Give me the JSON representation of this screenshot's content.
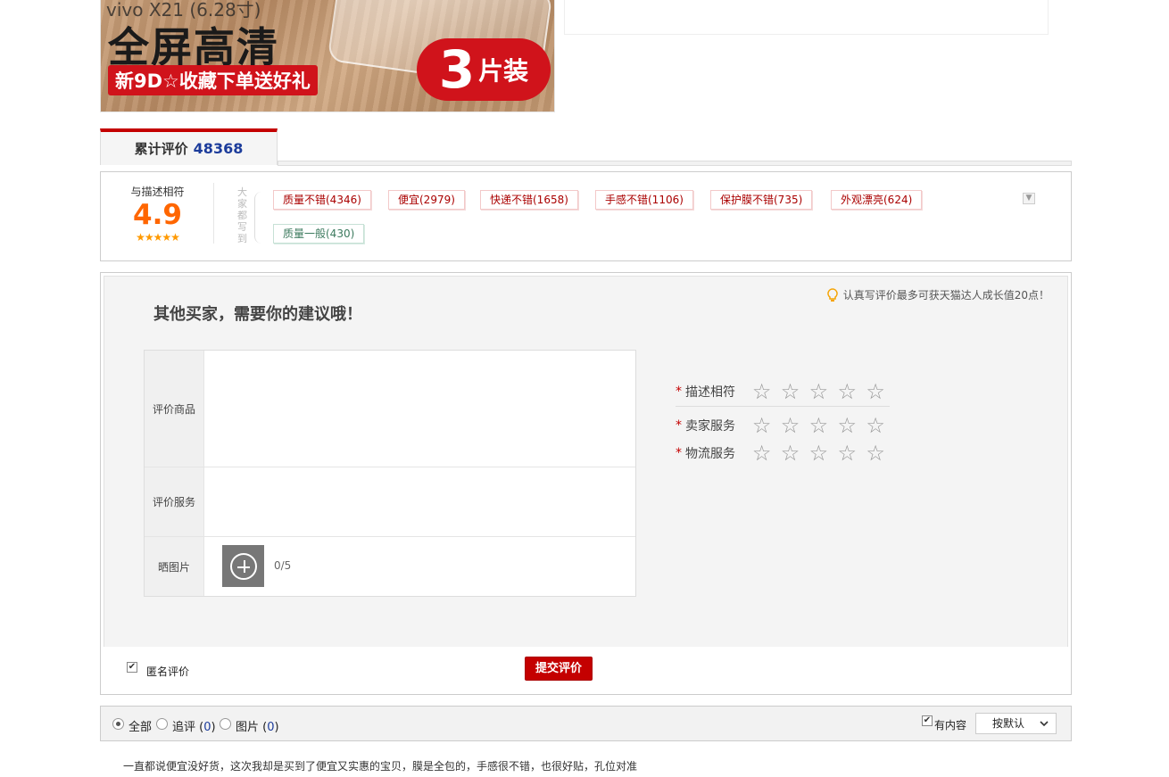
{
  "banner": {
    "model": "vivo X21 (6.28寸)",
    "headline": "全屏高清",
    "promo": "新9D☆收藏下单送好礼",
    "pack_num": "3",
    "pack_unit": "片装"
  },
  "tab": {
    "label": "累计评价",
    "count": "48368"
  },
  "summary": {
    "match_label": "与描述相符",
    "score": "4.9",
    "stars": "★★★★★",
    "everyone_label": "大家都写到",
    "tags": [
      {
        "text": "质量不错(4346)"
      },
      {
        "text": "便宜(2979)"
      },
      {
        "text": "快递不错(1658)"
      },
      {
        "text": "手感不错(1106)"
      },
      {
        "text": "保护膜不错(735)"
      },
      {
        "text": "外观漂亮(624)"
      },
      {
        "text": "质量一般(430)"
      }
    ]
  },
  "form": {
    "title": "其他买家，需要你的建议哦！",
    "tip": "认真写评价最多可获天猫达人成长值20点！",
    "rows": [
      {
        "label": "评价商品"
      },
      {
        "label": "评价服务"
      },
      {
        "label": "晒图片"
      }
    ],
    "photo_count": "0/5",
    "ratings": [
      {
        "label": "描述相符"
      },
      {
        "label": "卖家服务"
      },
      {
        "label": "物流服务"
      }
    ],
    "required_mark": "*",
    "empty_star": "☆",
    "anonymous_label": "匿名评价",
    "anonymous_checked": true,
    "submit_label": "提交评价"
  },
  "filter": {
    "options": [
      {
        "label": "全部",
        "count": "",
        "selected": true
      },
      {
        "label": "追评",
        "count": "0",
        "selected": false
      },
      {
        "label": "图片",
        "count": "0",
        "selected": false
      }
    ],
    "has_content_label": "有内容",
    "has_content_checked": true,
    "sort_label": "按默认"
  },
  "review": {
    "text": "一直都说便宜没好货，这次我却是买到了便宜又实惠的宝贝，膜是全包的，手感很不错，也很好贴，孔位对准"
  },
  "colors": {
    "accent_red": "#c40000",
    "score_orange": "#ff6600",
    "count_blue": "#1c3c9b"
  }
}
